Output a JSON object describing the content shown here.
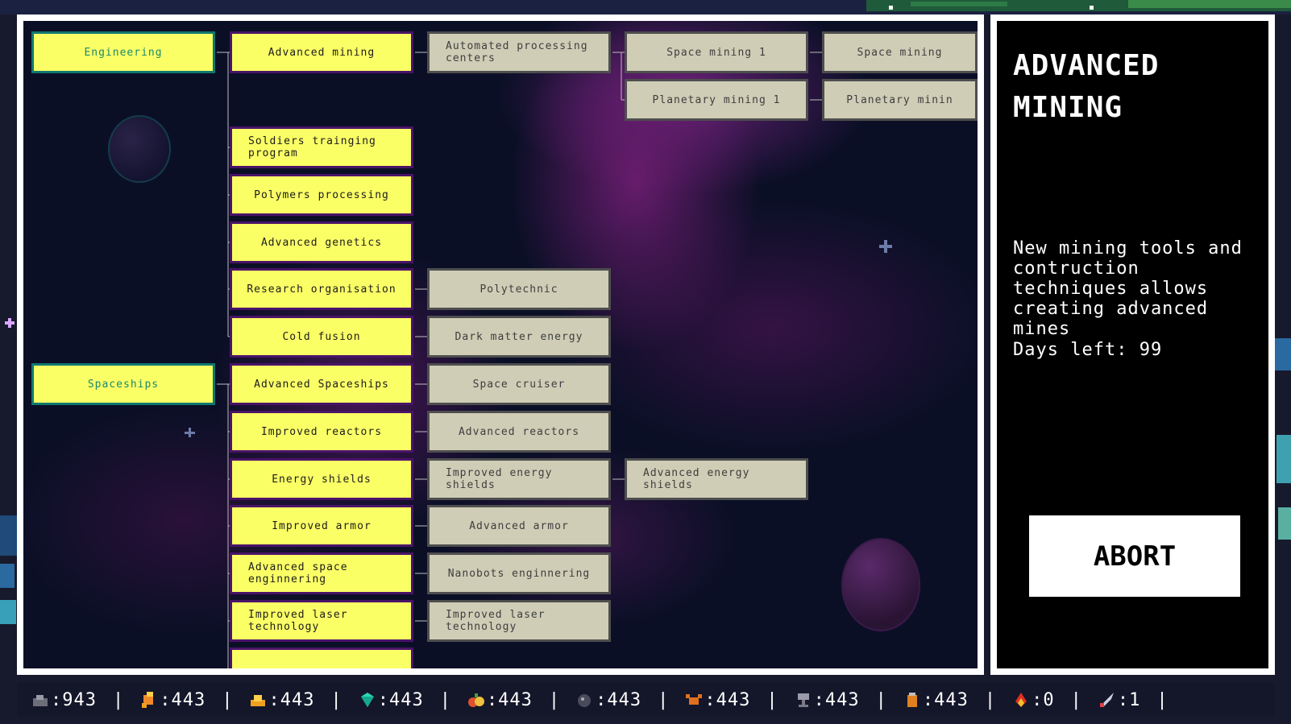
{
  "tech_tree": {
    "categories": [
      {
        "id": "engineering",
        "label": "Engineering"
      },
      {
        "id": "spaceships",
        "label": "Spaceships"
      }
    ],
    "nodes": {
      "engineering": "Engineering",
      "advanced_mining": "Advanced mining",
      "automated_processing": "Automated processing centers",
      "space_mining_1": "Space mining 1",
      "space_mining_2": "Space mining",
      "planetary_mining_1": "Planetary mining 1",
      "planetary_mining_2": "Planetary minin",
      "soldiers_training": "Soldiers trainging program",
      "polymers_processing": "Polymers processing",
      "advanced_genetics": "Advanced genetics",
      "research_organisation": "Research organisation",
      "polytechnic": "Polytechnic",
      "cold_fusion": "Cold fusion",
      "dark_matter_energy": "Dark matter energy",
      "spaceships": "Spaceships",
      "advanced_spaceships": "Advanced Spaceships",
      "space_cruiser": "Space cruiser",
      "improved_reactors": "Improved reactors",
      "advanced_reactors": "Advanced reactors",
      "energy_shields": "Energy shields",
      "improved_energy_shields": "Improved energy shields",
      "advanced_energy_shields": "Advanced energy shields",
      "improved_armor": "Improved armor",
      "advanced_armor": "Advanced armor",
      "advanced_space_enginnering": "Advanced space enginnering",
      "nanobots_enginnering": "Nanobots enginnering",
      "improved_laser_1": "Improved laser technology",
      "improved_laser_2": "Improved laser technology",
      "partial_node": ""
    }
  },
  "info_panel": {
    "title": "ADVANCED MINING",
    "description": "New mining tools and contruction techniques allows creating advanced mines",
    "days_label": "Days left:",
    "days_value": "99",
    "abort_label": "ABORT"
  },
  "resources": [
    {
      "icon": "ore-icon",
      "value": "943"
    },
    {
      "icon": "energy-icon",
      "value": "443"
    },
    {
      "icon": "gold-icon",
      "value": "443"
    },
    {
      "icon": "gem-icon",
      "value": "443"
    },
    {
      "icon": "food-icon",
      "value": "443"
    },
    {
      "icon": "bomb-icon",
      "value": "443"
    },
    {
      "icon": "crab-icon",
      "value": "443"
    },
    {
      "icon": "chalice-icon",
      "value": "443"
    },
    {
      "icon": "jar-icon",
      "value": "443"
    },
    {
      "icon": "fire-icon",
      "value": "0"
    },
    {
      "icon": "rocket-icon",
      "value": "1"
    }
  ],
  "resource_separator": ":",
  "colors": {
    "node_yellow": "#fbff66",
    "category_border": "#107870",
    "category_text": "#1a8a6e",
    "locked_bg": "#cfcdb6",
    "panel_bg": "#000000"
  }
}
